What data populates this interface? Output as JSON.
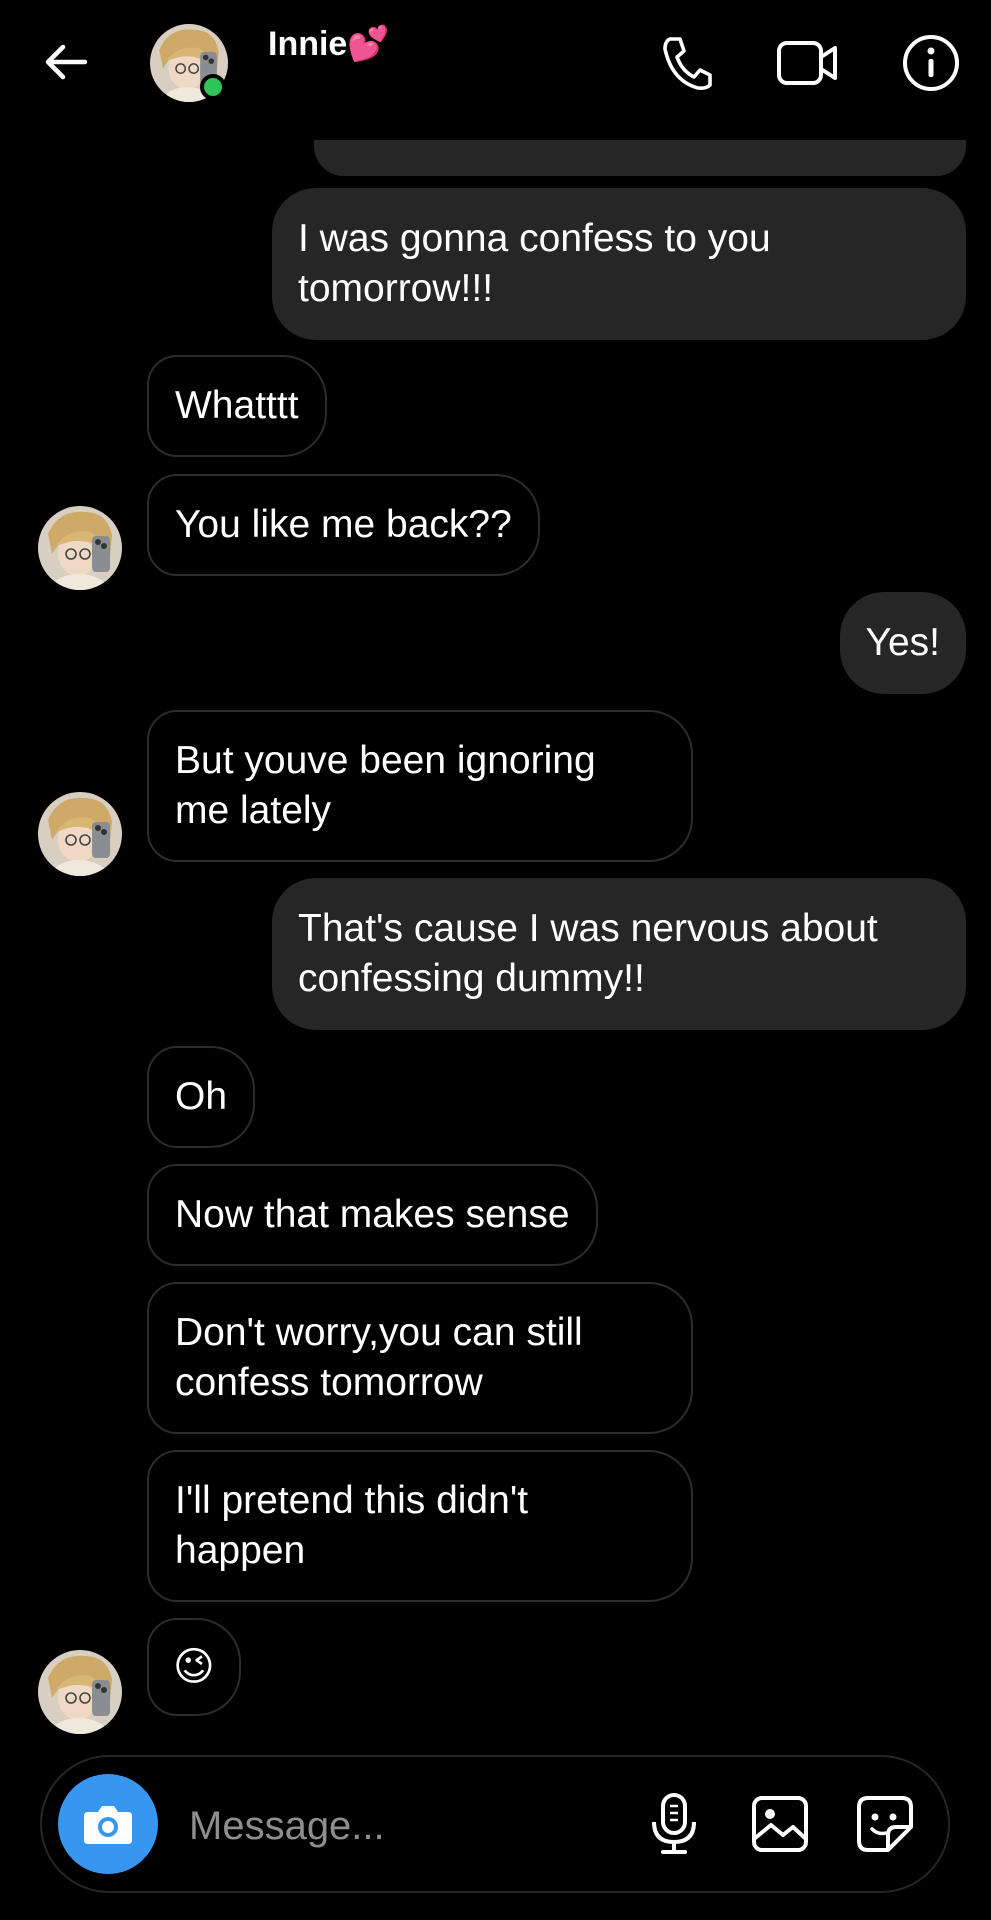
{
  "header": {
    "contact_name": "Innie💕",
    "status": "online"
  },
  "messages": [
    {
      "side": "out",
      "text": "I was gonna confess to you\ntomorrow!!!"
    },
    {
      "side": "in",
      "text": "Whatttt"
    },
    {
      "side": "in",
      "text": "You like me back??"
    },
    {
      "side": "out",
      "text": "Yes!"
    },
    {
      "side": "in",
      "text": "But youve been ignoring\nme lately"
    },
    {
      "side": "out",
      "text": "That's cause I was nervous about\nconfessing dummy!!"
    },
    {
      "side": "in",
      "text": "Oh"
    },
    {
      "side": "in",
      "text": "Now that makes sense"
    },
    {
      "side": "in",
      "text": "Don't worry,you can still\nconfess tomorrow"
    },
    {
      "side": "in",
      "text": "I'll pretend this didn't\nhappen"
    },
    {
      "side": "in",
      "text": "😉"
    }
  ],
  "composer": {
    "placeholder": "Message..."
  },
  "colors": {
    "background": "#000000",
    "outgoing_bubble": "#262626",
    "incoming_border": "#2c2c2c",
    "camera_button": "#3797f0",
    "online": "#2fc45a"
  },
  "icons": [
    "back-arrow-icon",
    "phone-icon",
    "video-camera-icon",
    "info-icon",
    "camera-icon",
    "microphone-icon",
    "gallery-icon",
    "sticker-icon"
  ]
}
